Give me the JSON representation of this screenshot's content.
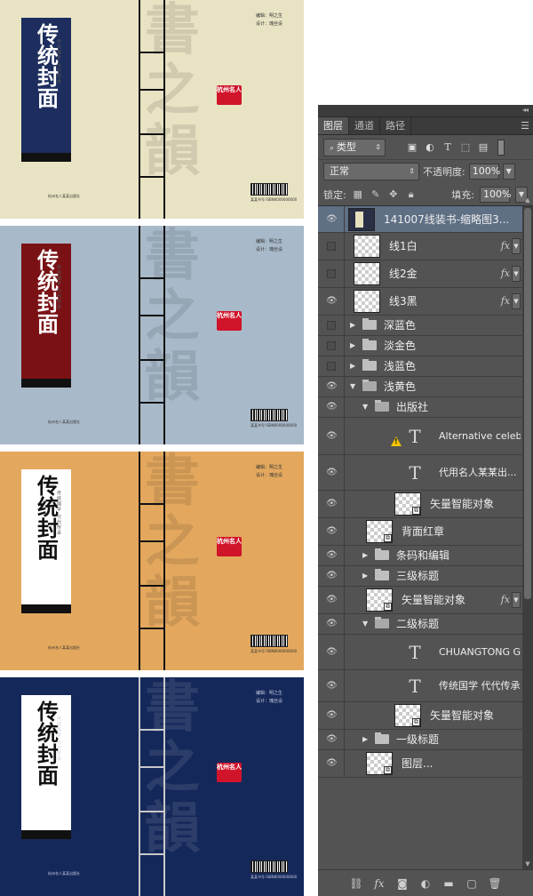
{
  "covers": [
    {
      "bg": "#e8e3c3",
      "title_bg": "#1c2d5e",
      "title_color": "#ffffff",
      "title": "传统封面",
      "subtitle": "传统国学 代代传承",
      "credits": [
        "编辑：明之生",
        "设计：瑰丝设"
      ],
      "publisher": "杭州名人某某出版社",
      "seal": "杭州名人",
      "barcode_text": "某某书号 ISBN0000000000"
    },
    {
      "bg": "#a8b9c9",
      "title_bg": "#7a1215",
      "title_color": "#ffffff",
      "title": "传统封面",
      "subtitle": "传统国学 代代传承",
      "credits": [
        "编辑：明之生",
        "设计：瑰丝设"
      ],
      "publisher": "杭州名人某某出版社",
      "seal": "杭州名人",
      "barcode_text": "某某书号 ISBN0000000000"
    },
    {
      "bg": "#e3a85e",
      "title_bg": "#ffffff",
      "title_color": "#111111",
      "title": "传统封面",
      "subtitle": "传统国学 代代传承",
      "credits": [
        "编辑：明之生",
        "设计：瑰丝设"
      ],
      "publisher": "杭州名人某某出版社",
      "seal": "杭州名人",
      "barcode_text": "某某书号 ISBN0000000000"
    },
    {
      "bg": "#15285a",
      "title_bg": "#ffffff",
      "title_color": "#111111",
      "title": "传统封面",
      "subtitle": "传统国学 代代传承",
      "credits": [
        "编辑：明之生",
        "设计：瑰丝设"
      ],
      "publisher": "杭州名人某某出版社",
      "seal": "杭州名人",
      "barcode_text": "某某书号 ISBN0000000000"
    }
  ],
  "panel": {
    "tabs": [
      "图层",
      "通道",
      "路径"
    ],
    "active_tab": "图层",
    "filter_label": "类型",
    "blend_mode": "正常",
    "opacity_label": "不透明度:",
    "opacity_value": "100%",
    "lock_label": "锁定:",
    "fill_label": "填充:",
    "fill_value": "100%"
  },
  "layers": [
    {
      "name": "141007线装书-缩略图3...",
      "kind": "image",
      "depth": 0,
      "visible": true,
      "selected": true
    },
    {
      "name": "线1白",
      "kind": "pixel",
      "depth": 0,
      "visible": false,
      "fx": true
    },
    {
      "name": "线2金",
      "kind": "pixel",
      "depth": 0,
      "visible": false,
      "fx": true
    },
    {
      "name": "线3黑",
      "kind": "pixel",
      "depth": 0,
      "visible": true,
      "fx": true
    },
    {
      "name": "深蓝色",
      "kind": "group",
      "depth": 0,
      "visible": false,
      "open": false
    },
    {
      "name": "淡金色",
      "kind": "group",
      "depth": 0,
      "visible": false,
      "open": false
    },
    {
      "name": "浅蓝色",
      "kind": "group",
      "depth": 0,
      "visible": false,
      "open": false
    },
    {
      "name": "浅黄色",
      "kind": "group",
      "depth": 0,
      "visible": true,
      "open": true
    },
    {
      "name": "出版社",
      "kind": "group",
      "depth": 1,
      "visible": true,
      "open": true
    },
    {
      "name": "Alternative celebrit...",
      "kind": "text",
      "depth": 2,
      "visible": true,
      "warning": true
    },
    {
      "name": "代用名人某某出...",
      "kind": "text",
      "depth": 2,
      "visible": true
    },
    {
      "name": "矢量智能对象",
      "kind": "smart",
      "depth": 2,
      "visible": true
    },
    {
      "name": "背面红章",
      "kind": "smart",
      "depth": 1,
      "visible": true
    },
    {
      "name": "条码和编辑",
      "kind": "group",
      "depth": 1,
      "visible": true,
      "open": false
    },
    {
      "name": "三级标题",
      "kind": "group",
      "depth": 1,
      "visible": true,
      "open": false
    },
    {
      "name": "矢量智能对象",
      "kind": "smart",
      "depth": 1,
      "visible": true,
      "fx": true
    },
    {
      "name": "二级标题",
      "kind": "group",
      "depth": 1,
      "visible": true,
      "open": true
    },
    {
      "name": "CHUANGTONG GU...",
      "kind": "text",
      "depth": 2,
      "visible": true
    },
    {
      "name": "传统国学 代代传承",
      "kind": "text",
      "depth": 2,
      "visible": true
    },
    {
      "name": "矢量智能对象",
      "kind": "smart",
      "depth": 2,
      "visible": true
    },
    {
      "name": "一级标题",
      "kind": "group",
      "depth": 1,
      "visible": true,
      "open": false
    },
    {
      "name": "图层...",
      "kind": "smart",
      "depth": 1,
      "visible": true
    }
  ],
  "icons": {
    "eye": "eye-icon",
    "folder": "folder-icon",
    "text_layer": "text-layer-icon",
    "warning": "warning-icon",
    "fx": "fx-icon",
    "bottom": [
      "link-icon",
      "fx-icon",
      "mask-icon",
      "adjustment-icon",
      "new-group-icon",
      "new-layer-icon",
      "trash-icon"
    ]
  }
}
